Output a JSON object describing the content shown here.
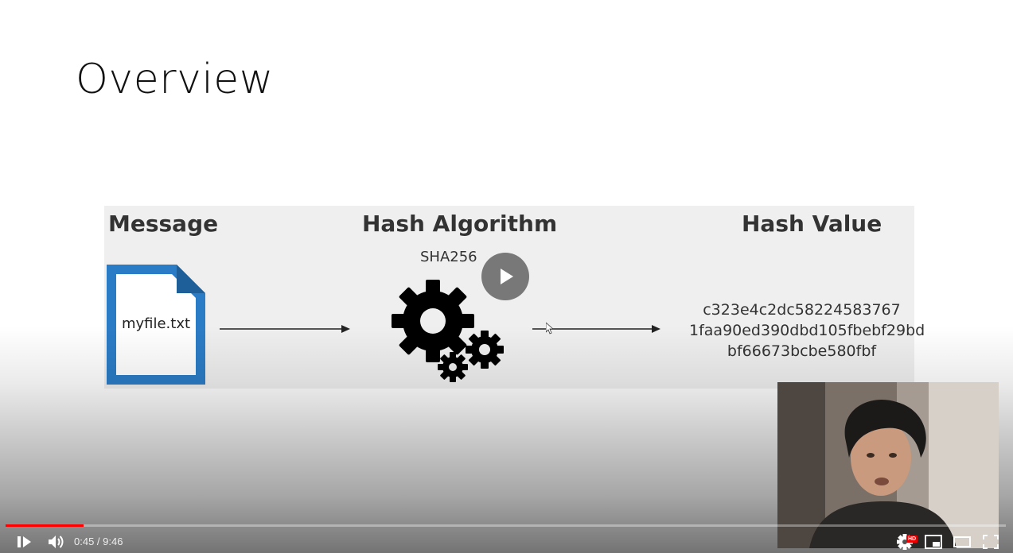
{
  "slide": {
    "title": "Overview",
    "diagram": {
      "message_header": "Message",
      "algorithm_header": "Hash Algorithm",
      "hash_value_header": "Hash Value",
      "algorithm_name": "SHA256",
      "file_name": "myfile.txt",
      "hash_lines": [
        "c323e4c2dc58224583767",
        "1faa90ed390dbd105fbebf29bd",
        "bf66673bcbe580fbf"
      ],
      "file_color": "#2b7cc6"
    }
  },
  "player": {
    "current_time": "0:45",
    "separator": " / ",
    "duration": "9:46",
    "hd_badge": "HD",
    "progress_fraction": 0.0776,
    "accent_color": "#ff0000",
    "icons": [
      "play-pause-icon",
      "volume-icon",
      "settings-icon",
      "miniplayer-icon",
      "theater-mode-icon",
      "fullscreen-icon",
      "big-play-icon"
    ]
  }
}
